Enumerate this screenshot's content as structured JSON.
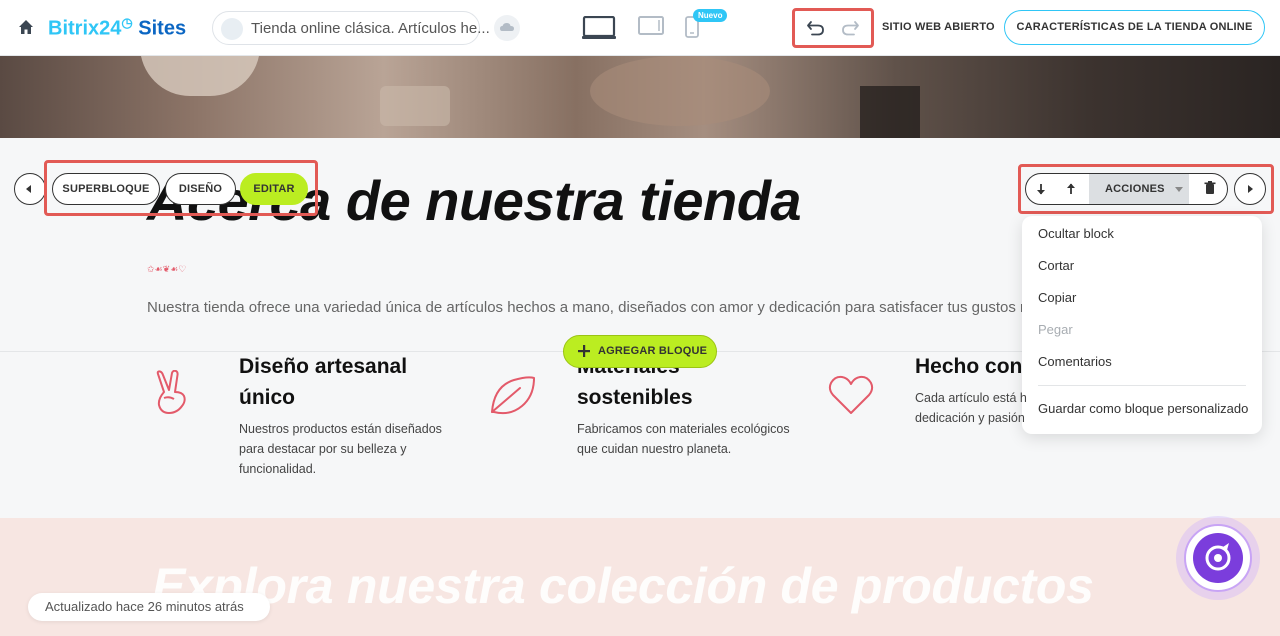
{
  "header": {
    "logo_main": "Bitrix24",
    "logo_suffix": "Sites",
    "site_title": "Tienda online clásica. Artículos he...",
    "new_badge": "Nuevo",
    "open_site": "SITIO WEB ABIERTO",
    "store_features": "CARACTERÍSTICAS DE LA TIENDA ONLINE"
  },
  "block_controls": {
    "superblock": "SUPERBLOQUE",
    "design": "DISEÑO",
    "edit": "EDITAR",
    "actions": "ACCIONES"
  },
  "menu": {
    "items": [
      {
        "label": "Ocultar block",
        "enabled": true
      },
      {
        "label": "Cortar",
        "enabled": true
      },
      {
        "label": "Copiar",
        "enabled": true
      },
      {
        "label": "Pegar",
        "enabled": false
      },
      {
        "label": "Comentarios",
        "enabled": true
      },
      {
        "label": "Guardar como bloque personalizado",
        "enabled": true
      }
    ]
  },
  "about": {
    "title": "Acerca de nuestra tienda",
    "decoration": "✩☙❦☙♡",
    "description": "Nuestra tienda ofrece una variedad única de artículos hechos a mano, diseñados con amor y dedicación para satisfacer tus gustos más exi"
  },
  "add_block": "AGREGAR BLOQUE",
  "features": [
    {
      "icon": "victory-hand-icon",
      "title_line1": "Diseño artesanal",
      "title_line2": "único",
      "desc_line1": "Nuestros productos están diseñados",
      "desc_line2": "para destacar por su belleza y",
      "desc_line3": "funcionalidad."
    },
    {
      "icon": "leaf-icon",
      "title_line1": "Materiales",
      "title_line2": "sostenibles",
      "desc_line1": "Fabricamos con materiales ecológicos",
      "desc_line2": "que cuidan nuestro planeta."
    },
    {
      "icon": "heart-icon",
      "title_line1": "Hecho con",
      "desc_line1": "Cada artículo está h",
      "desc_line2": "dedicación y pasión"
    }
  ],
  "collection_title": "Explora nuestra colección de productos",
  "status": "Actualizado hace 26 minutos atrás",
  "colors": {
    "accent_blue": "#2fc6f6",
    "lime": "#bbed21",
    "highlight_red": "#e25a55",
    "feature_icon": "#e35a6a",
    "copilot": "#7b3ddc"
  }
}
